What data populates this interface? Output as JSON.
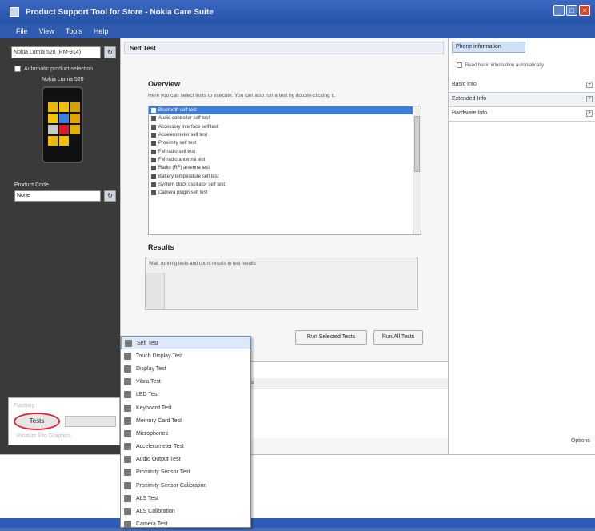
{
  "window": {
    "title": "Product Support Tool for Store - Nokia Care Suite"
  },
  "menubar": {
    "items": [
      "File",
      "View",
      "Tools",
      "Help"
    ]
  },
  "left": {
    "device_combo": "Nokia Lumia 520 (RM-914)",
    "connect_label": "Automatic product selection",
    "model": "Nokia Lumia 520",
    "product_code_label": "Product Code",
    "product_code_value": "None"
  },
  "start_panel": {
    "top_text": "Flashing",
    "tests_label": "Tests",
    "bottom_text": "Product Info Graphics"
  },
  "center": {
    "header": "Self Test",
    "overview_title": "Overview",
    "overview_desc": "Here you can select tests to execute. You can also run a test by double-clicking it.",
    "tests": [
      "Bluetooth self test",
      "Audio controller self test",
      "Accessory interface self test",
      "Accelerometer self test",
      "Proximity self test",
      "FM radio self test",
      "FM radio antenna test",
      "Radio (RF) antenna test",
      "Battery temperature self test",
      "System clock oscillator self test",
      "Camera plugin self test"
    ],
    "results_title": "Results",
    "results_text": "Wait: running tests and count results in test results",
    "run_selected": "Run Selected Tests",
    "run_all": "Run All Tests",
    "lower_bar_text": "Status"
  },
  "right": {
    "tab": "Phone information",
    "checkbox_label": "Read basic information automatically",
    "rows": [
      "Basic Info",
      "Extended Info",
      "Hardware Info"
    ],
    "footer": "Options"
  },
  "dropdown": {
    "items": [
      "Self Test",
      "Touch Display Test",
      "Display Test",
      "Vibra Test",
      "LED Test",
      "Keyboard Test",
      "Memory Card Test",
      "Microphones",
      "Accelerometer Test",
      "Audio Output Test",
      "Proximity Sensor Test",
      "Proximity Sensor Calibration",
      "ALS Test",
      "ALS Calibration",
      "Camera Test"
    ]
  },
  "colors": {
    "titlebar": "#2553a8",
    "selection": "#3b7fd8",
    "tests_highlight": "#dd2233"
  }
}
